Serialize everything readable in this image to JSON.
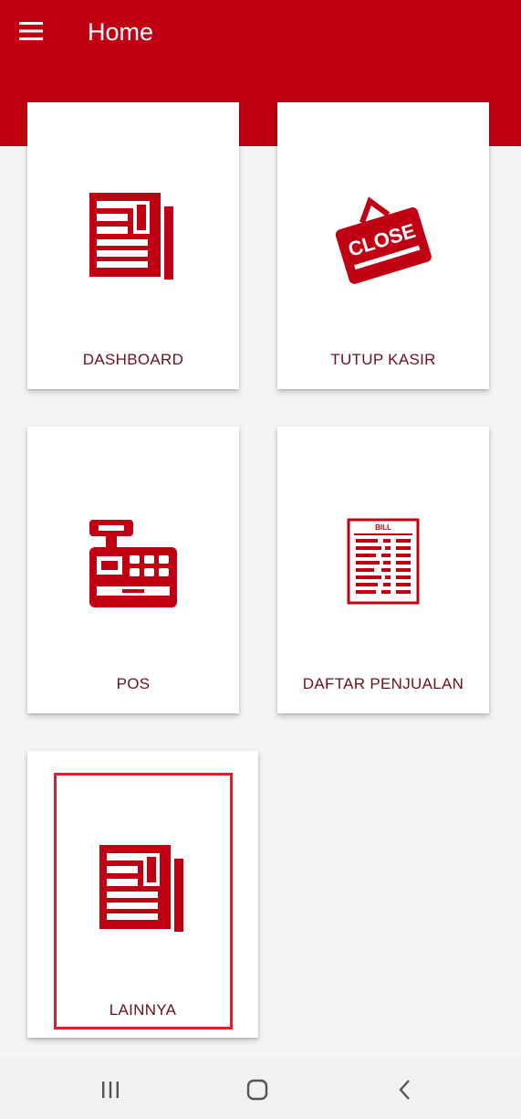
{
  "app_bar": {
    "title": "Home",
    "color": "#c00012"
  },
  "menu_items": [
    {
      "label": "DASHBOARD",
      "icon": "newspaper-icon"
    },
    {
      "label": "TUTUP KASIR",
      "icon": "close-sign-icon",
      "sign_text": "CLOSE"
    },
    {
      "label": "POS",
      "icon": "cash-register-icon"
    },
    {
      "label": "DAFTAR PENJUALAN",
      "icon": "bill-icon",
      "bill_text": "BILL"
    },
    {
      "label": "LAINNYA",
      "icon": "newspaper-icon",
      "highlighted": true
    }
  ],
  "nav_bar": {
    "buttons": [
      "recent-apps-icon",
      "home-icon",
      "back-icon"
    ]
  },
  "colors": {
    "accent": "#c00012",
    "label_text": "#6a1020",
    "highlight_border": "#d8232a"
  }
}
